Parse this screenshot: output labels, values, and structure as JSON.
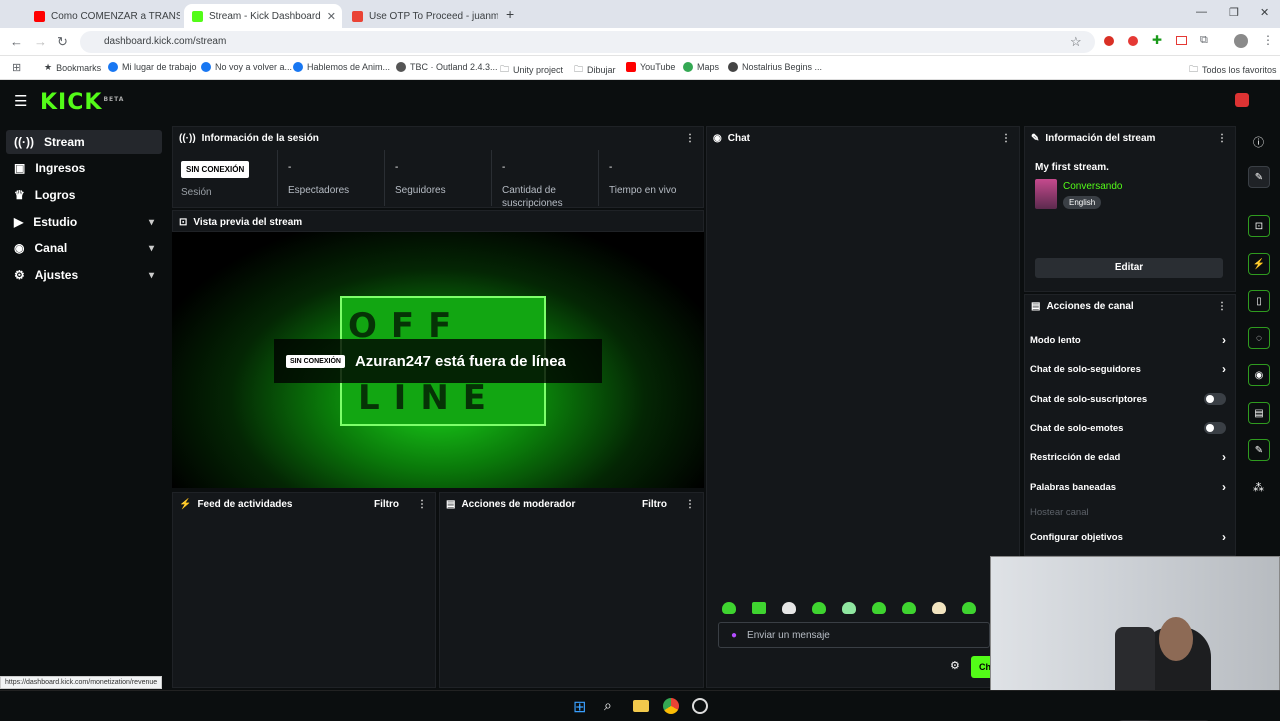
{
  "browser": {
    "tabs": [
      {
        "title": "Como COMENZAR a TRANSMI",
        "color": "#ff0000"
      },
      {
        "title": "Stream - Kick Dashboard",
        "color": "#53fc18"
      },
      {
        "title": "Use OTP To Proceed - juanman",
        "color": "#ea4335"
      }
    ],
    "url": "dashboard.kick.com/stream",
    "bookmarks": [
      "Bookmarks",
      "Mi lugar de trabajo",
      "No voy a volver a...",
      "Hablemos de Anim...",
      "TBC · Outland 2.4.3...",
      "Unity project",
      "Dibujar",
      "YouTube",
      "Maps",
      "Nostalrius Begins ..."
    ],
    "all_bookmarks": "Todos los favoritos",
    "status_url": "https://dashboard.kick.com/monetization/revenue"
  },
  "logo": {
    "text": "KICK",
    "beta": "BETA"
  },
  "sidebar": {
    "items": [
      {
        "label": "Stream"
      },
      {
        "label": "Ingresos"
      },
      {
        "label": "Logros"
      },
      {
        "label": "Estudio"
      },
      {
        "label": "Canal"
      },
      {
        "label": "Ajustes"
      }
    ]
  },
  "session": {
    "title": "Información de la sesión",
    "status_badge": "SIN CONEXIÓN",
    "session_label": "Sesión",
    "stats": [
      {
        "value": "-",
        "label": "Espectadores"
      },
      {
        "value": "-",
        "label": "Seguidores"
      },
      {
        "value": "-",
        "label": "Cantidad de suscripciones"
      },
      {
        "value": "-",
        "label": "Tiempo en vivo"
      }
    ]
  },
  "preview": {
    "title": "Vista previa del stream",
    "badge": "SIN CONEXIÓN",
    "message": "Azuran247 está fuera de línea",
    "board_top": "OFF",
    "board_bottom": "LINE"
  },
  "feed": {
    "title": "Feed de actividades",
    "filter": "Filtro"
  },
  "moderator": {
    "title": "Acciones de moderador",
    "filter": "Filtro"
  },
  "chat": {
    "title": "Chat",
    "placeholder": "Enviar un mensaje",
    "send": "Ch"
  },
  "stream_info": {
    "title": "Información del stream",
    "stream_title": "My first stream.",
    "category": "Conversando",
    "language": "English",
    "edit": "Editar"
  },
  "channel_actions": {
    "title": "Acciones de canal",
    "items": [
      {
        "label": "Modo lento",
        "kind": "arrow"
      },
      {
        "label": "Chat de solo-seguidores",
        "kind": "arrow"
      },
      {
        "label": "Chat de solo-suscriptores",
        "kind": "toggle"
      },
      {
        "label": "Chat de solo-emotes",
        "kind": "toggle"
      },
      {
        "label": "Restricción de edad",
        "kind": "arrow"
      },
      {
        "label": "Palabras baneadas",
        "kind": "arrow"
      },
      {
        "label": "Hostear canal",
        "kind": "disabled"
      },
      {
        "label": "Configurar objetivos",
        "kind": "arrow"
      }
    ]
  },
  "colors": {
    "accent": "#53fc18",
    "panel": "#14171a",
    "background": "#0b0e0f"
  }
}
